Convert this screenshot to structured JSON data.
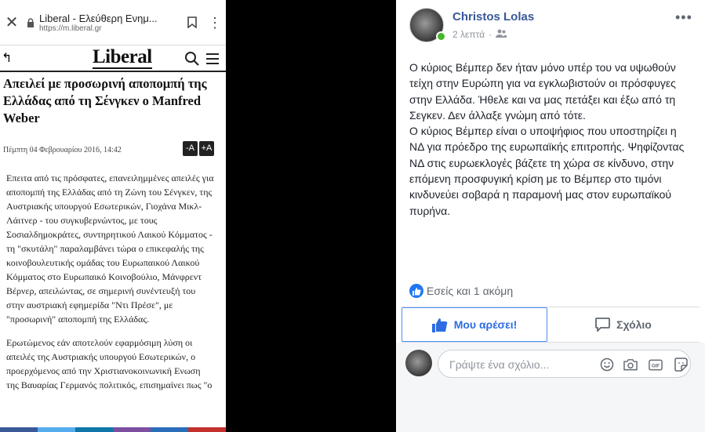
{
  "browser": {
    "tab_title": "Liberal - Ελεύθερη Ενημ...",
    "url": "https://m.liberal.gr"
  },
  "site": {
    "logo": "Liberal"
  },
  "article": {
    "headline": "Απειλεί με προσωρινή αποπομπή της Ελλάδας από τη Σένγκεν ο Manfred Weber",
    "date": "Πέμπτη 04 Φεβρουαρίου 2016, 14:42",
    "font_minus": "-A",
    "font_plus": "+A",
    "paragraphs": [
      "Επειτα από τις πρόσφατες, επανειλημμένες απειλές για αποπομπή της Ελλάδας από τη Ζώνη του Σένγκεν, της Αυστριακής υπουργού Εσωτερικών, Γιοχάνα Μικλ-Λάιτνερ - του συγκυβερνώντος, με τους Σοσιαλδημοκράτες, συντηρητικού Λαικού Κόμματος - τη \"σκυτάλη\" παραλαμβάνει τώρα ο επικεφαλής της κοινοβουλευτικής ομάδας του Ευρωπαικού Λαικού Κόμματος στο Ευρωπαικό Κοινοβούλιο, Μάνφρεντ Βέρνερ, απειλώντας, σε σημερινή συνέντευξή του στην αυστριακή εφημερίδα \"Ντι Πρέσε\", με \"προσωρινή\" αποπομπή της Ελλάδας.",
      "Ερωτώμενος εάν αποτελούν εφαρμόσιμη λύση οι απειλές της Αυστριακής υπουργού Εσωτερικών, ο προερχόμενος από την Χριστιανοκοινωνική Ενωση της Βαυαρίας Γερμανός πολιτικός, επισημαίνει πως \"ο"
    ]
  },
  "post": {
    "author": "Christos Lolas",
    "time": "2 λεπτά",
    "dot": "·",
    "text_lines": [
      "Ο κύριος Βέμπερ δεν ήταν μόνο υπέρ του να υψωθούν τείχη στην Ευρώπη για να εγκλωβιστούν οι πρόσφυγες στην Ελλάδα. Ήθελε και να μας πετάξει και έξω από τη Σεγκεν. Δεν άλλαξε γνώμη από τότε.",
      "Ο κύριος Βέμπερ είναι ο υποψήφιος που υποστηρίζει η ΝΔ για πρόεδρο της ευρωπαϊκής επιτροπής. Ψηφίζοντας ΝΔ στις ευρωεκλογές βάζετε τη χώρα σε κίνδυνο, στην επόμενη προσφυγική κρίση με το Βέμπερ στο τιμόνι κινδυνεύει σοβαρά η παραμονή μας στον ευρωπαϊκού πυρήνα."
    ],
    "reactions": "Εσείς και 1 ακόμη",
    "like_label": "Μου αρέσει!",
    "comment_label": "Σχόλιο",
    "comment_placeholder": "Γράψτε ένα σχόλιο...",
    "more_label": "•••",
    "gif_label": "GIF"
  },
  "colors": {
    "fb_blue": "#385898",
    "like_blue": "#2d6de0",
    "online_green": "#42b72a"
  },
  "share_colors": [
    "#3b5998",
    "#55acee",
    "#0e76a8",
    "#7d4fa0",
    "#2a6dba",
    "#c2312c"
  ]
}
